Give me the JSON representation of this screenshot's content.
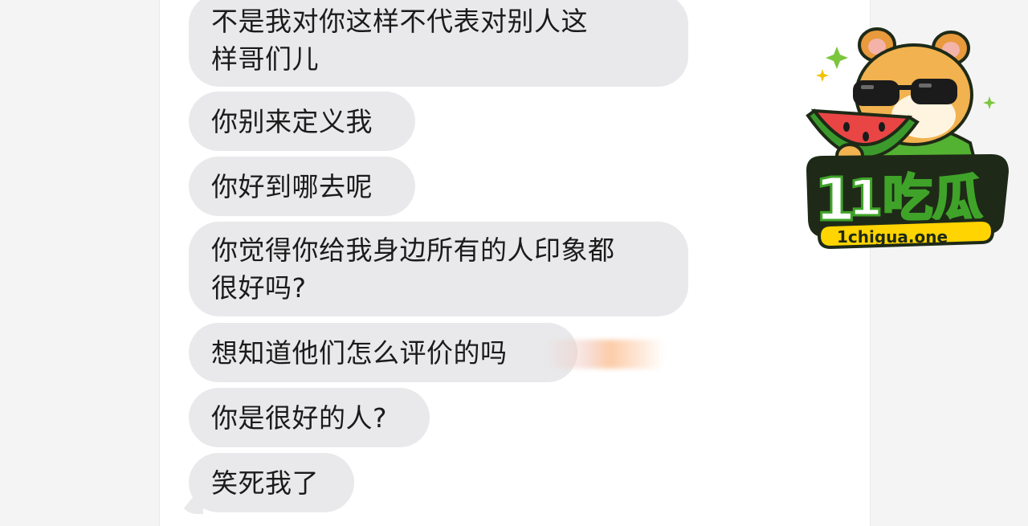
{
  "chat": {
    "messages": [
      {
        "lines": [
          "不是我对你这样不代表对别人这",
          "样哥们儿"
        ]
      },
      {
        "lines": [
          "你别来定义我"
        ]
      },
      {
        "lines": [
          "你好到哪去呢"
        ]
      },
      {
        "lines": [
          "你觉得你给我身边所有的人印象都",
          "很好吗?"
        ]
      },
      {
        "lines": [
          "想知道他们怎么评价的吗"
        ]
      },
      {
        "lines": [
          "你是很好的人?"
        ]
      },
      {
        "lines": [
          "笑死我了"
        ]
      }
    ]
  },
  "watermark": {
    "brand_cn": "1吃瓜",
    "brand_url": "1chigua.one",
    "icon": "hamster-watermelon-mascot-icon"
  },
  "colors": {
    "bubble": "#e9e9eb",
    "text": "#1b1b1b",
    "logo_green": "#3fa329",
    "logo_dark": "#1e2a17"
  }
}
